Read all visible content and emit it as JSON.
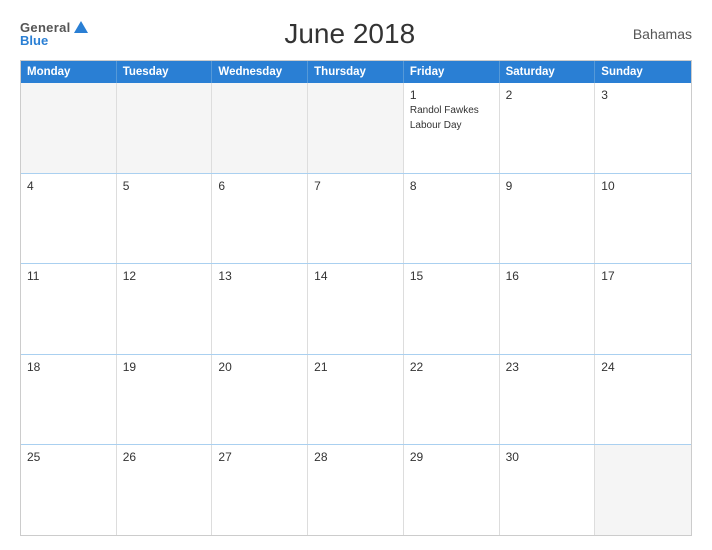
{
  "header": {
    "logo_general": "General",
    "logo_blue": "Blue",
    "title": "June 2018",
    "country": "Bahamas"
  },
  "weekdays": [
    "Monday",
    "Tuesday",
    "Wednesday",
    "Thursday",
    "Friday",
    "Saturday",
    "Sunday"
  ],
  "rows": [
    [
      {
        "day": "",
        "empty": true
      },
      {
        "day": "",
        "empty": true
      },
      {
        "day": "",
        "empty": true
      },
      {
        "day": "",
        "empty": true
      },
      {
        "day": "1",
        "events": [
          "Randol Fawkes",
          "Labour Day"
        ]
      },
      {
        "day": "2"
      },
      {
        "day": "3"
      }
    ],
    [
      {
        "day": "4"
      },
      {
        "day": "5"
      },
      {
        "day": "6"
      },
      {
        "day": "7"
      },
      {
        "day": "8"
      },
      {
        "day": "9"
      },
      {
        "day": "10"
      }
    ],
    [
      {
        "day": "11"
      },
      {
        "day": "12"
      },
      {
        "day": "13"
      },
      {
        "day": "14"
      },
      {
        "day": "15"
      },
      {
        "day": "16"
      },
      {
        "day": "17"
      }
    ],
    [
      {
        "day": "18"
      },
      {
        "day": "19"
      },
      {
        "day": "20"
      },
      {
        "day": "21"
      },
      {
        "day": "22"
      },
      {
        "day": "23"
      },
      {
        "day": "24"
      }
    ],
    [
      {
        "day": "25"
      },
      {
        "day": "26"
      },
      {
        "day": "27"
      },
      {
        "day": "28"
      },
      {
        "day": "29"
      },
      {
        "day": "30"
      },
      {
        "day": "",
        "empty": true
      }
    ]
  ]
}
